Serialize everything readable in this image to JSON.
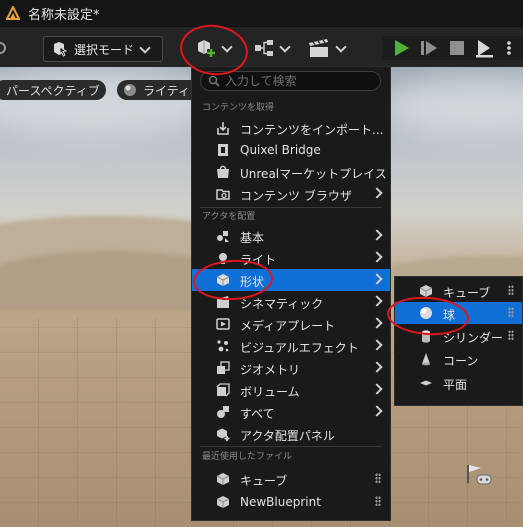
{
  "window": {
    "title": "名称未設定*"
  },
  "toolbar": {
    "mode_label": "選択モード",
    "icons": [
      "add-content-icon",
      "blueprint-icon",
      "cinematics-icon",
      "play-icon",
      "advance-frame-icon",
      "stop-icon",
      "eject-icon",
      "more-options-icon"
    ]
  },
  "viewport": {
    "perspective_label": "パースペクティブ",
    "lighting_label": "ライティン"
  },
  "menu": {
    "search_placeholder": "入力して検索",
    "sections": {
      "get_content": "コンテンツを取得",
      "place_actors": "アクタを配置",
      "recent_files": "最近使用したファイル"
    },
    "get_content_items": [
      {
        "label": "コンテンツをインポート...",
        "icon": "import-icon"
      },
      {
        "label": "Quixel Bridge",
        "icon": "quixel-bridge-icon"
      },
      {
        "label": "Unrealマーケットプレイス",
        "icon": "marketplace-icon"
      },
      {
        "label": "コンテンツ ブラウザ",
        "icon": "content-browser-icon"
      }
    ],
    "place_items": [
      {
        "label": "基本",
        "icon": "basic-icon"
      },
      {
        "label": "ライト",
        "icon": "light-icon"
      },
      {
        "label": "形状",
        "icon": "shapes-icon",
        "selected": true
      },
      {
        "label": "シネマティック",
        "icon": "cinematic-icon"
      },
      {
        "label": "メディアプレート",
        "icon": "media-plate-icon"
      },
      {
        "label": "ビジュアルエフェクト",
        "icon": "visual-effects-icon"
      },
      {
        "label": "ジオメトリ",
        "icon": "geometry-icon"
      },
      {
        "label": "ボリューム",
        "icon": "volume-icon"
      },
      {
        "label": "すべて",
        "icon": "all-icon"
      },
      {
        "label": "アクタ配置パネル",
        "icon": "place-actors-panel-icon"
      }
    ],
    "recent_items": [
      {
        "label": "キューブ",
        "icon": "cube-icon"
      },
      {
        "label": "NewBlueprint",
        "icon": "blueprint-icon"
      }
    ]
  },
  "submenu": {
    "items": [
      {
        "label": "キューブ",
        "icon": "cube-icon"
      },
      {
        "label": "球",
        "icon": "sphere-icon",
        "selected": true
      },
      {
        "label": "シリンダー",
        "icon": "cylinder-icon"
      },
      {
        "label": "コーン",
        "icon": "cone-icon"
      },
      {
        "label": "平面",
        "icon": "plane-icon"
      }
    ]
  },
  "colors": {
    "selection": "#0f6fd6",
    "play_green": "#4fb530",
    "annotation_red": "#e0161b",
    "menu_bg": "#1a1a1a"
  }
}
